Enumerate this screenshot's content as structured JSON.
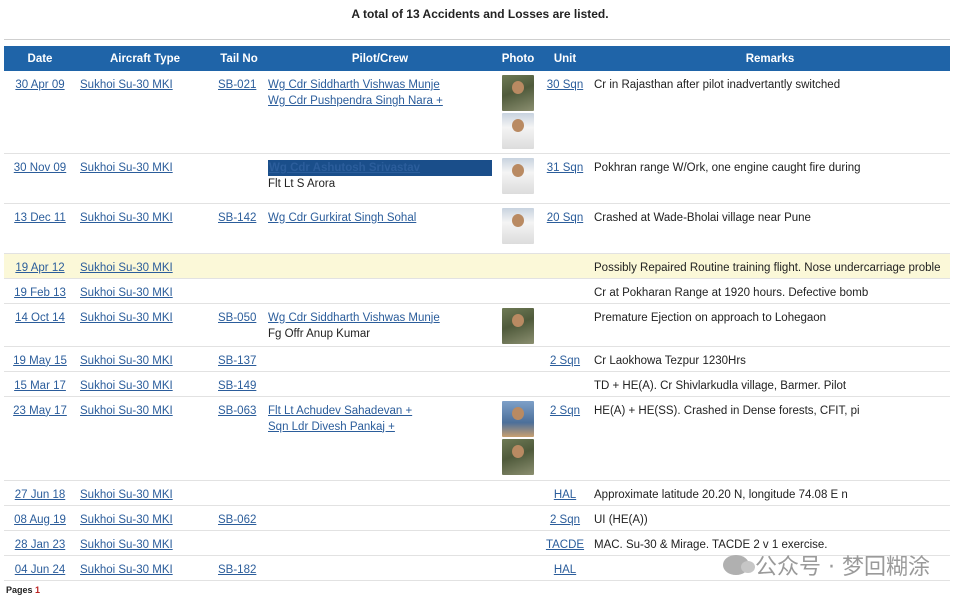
{
  "summary": "A total of 13 Accidents and Losses are listed.",
  "columns": [
    "Date",
    "Aircraft Type",
    "Tail No",
    "Pilot/Crew",
    "Photo",
    "Unit",
    "Remarks"
  ],
  "rows": [
    {
      "date": "30 Apr 09",
      "aircraft": "Sukhoi Su-30 MKI",
      "tail": "SB-021",
      "crew": [
        "Wg Cdr Siddharth Vishwas Munje",
        "Wg Cdr Pushpendra Singh Nara +"
      ],
      "crew_links": [
        true,
        true
      ],
      "photos": [
        "camo",
        "white"
      ],
      "unit": "30 Sqn",
      "remarks": "Cr in Rajasthan after pilot inadvertantly switched"
    },
    {
      "date": "30 Nov 09",
      "aircraft": "Sukhoi Su-30 MKI",
      "tail": "",
      "crew": [
        "Wg Cdr Ashutosh Srivastav",
        "Flt Lt S Arora"
      ],
      "crew_links": [
        true,
        false
      ],
      "photos": [
        "white"
      ],
      "unit": "31 Sqn",
      "remarks": "Pokhran range W/Ork, one engine caught fire during"
    },
    {
      "date": "13 Dec 11",
      "aircraft": "Sukhoi Su-30 MKI",
      "tail": "SB-142",
      "crew": [
        "Wg Cdr Gurkirat Singh Sohal"
      ],
      "crew_links": [
        true
      ],
      "photos": [
        "white"
      ],
      "unit": "20 Sqn",
      "remarks": "Crashed at Wade-Bholai village near Pune"
    },
    {
      "date": "19 Apr 12",
      "aircraft": "Sukhoi Su-30 MKI",
      "tail": "",
      "crew": [],
      "crew_links": [],
      "photos": [],
      "unit": "",
      "remarks": "Possibly Repaired Routine training flight. Nose undercarriage proble",
      "highlight": true
    },
    {
      "date": "19 Feb 13",
      "aircraft": "Sukhoi Su-30 MKI",
      "tail": "",
      "crew": [],
      "crew_links": [],
      "photos": [],
      "unit": "",
      "remarks": "Cr at Pokharan Range at 1920 hours. Defective bomb"
    },
    {
      "date": "14 Oct 14",
      "aircraft": "Sukhoi Su-30 MKI",
      "tail": "SB-050",
      "crew": [
        "Wg Cdr Siddharth Vishwas Munje",
        "Fg Offr Anup Kumar"
      ],
      "crew_links": [
        true,
        false
      ],
      "photos": [
        "camo"
      ],
      "unit": "",
      "remarks": "Premature Ejection on approach to Lohegaon"
    },
    {
      "date": "19 May 15",
      "aircraft": "Sukhoi Su-30 MKI",
      "tail": "SB-137",
      "crew": [],
      "crew_links": [],
      "photos": [],
      "unit": "2 Sqn",
      "remarks": "Cr Laokhowa Tezpur 1230Hrs"
    },
    {
      "date": "15 Mar 17",
      "aircraft": "Sukhoi Su-30 MKI",
      "tail": "SB-149",
      "crew": [],
      "crew_links": [],
      "photos": [],
      "unit": "",
      "remarks": "TD + HE(A). Cr Shivlarkudla village, Barmer. Pilot"
    },
    {
      "date": "23 May 17",
      "aircraft": "Sukhoi Su-30 MKI",
      "tail": "SB-063",
      "crew": [
        "Flt Lt Achudev Sahadevan +",
        "Sqn Ldr Divesh Pankaj +"
      ],
      "crew_links": [
        true,
        true
      ],
      "photos": [
        "blue",
        "camo"
      ],
      "unit": "2 Sqn",
      "remarks": "HE(A) + HE(SS). Crashed in Dense forests, CFIT, pi"
    },
    {
      "date": "27 Jun 18",
      "aircraft": "Sukhoi Su-30 MKI",
      "tail": "",
      "crew": [],
      "crew_links": [],
      "photos": [],
      "unit": "HAL",
      "remarks": "Approximate latitude 20.20 N, longitude 74.08 E n"
    },
    {
      "date": "08 Aug 19",
      "aircraft": "Sukhoi Su-30 MKI",
      "tail": "SB-062",
      "crew": [],
      "crew_links": [],
      "photos": [],
      "unit": "2 Sqn",
      "remarks": "UI (HE(A))"
    },
    {
      "date": "28 Jan 23",
      "aircraft": "Sukhoi Su-30 MKI",
      "tail": "",
      "crew": [],
      "crew_links": [],
      "photos": [],
      "unit": "TACDE",
      "remarks": "MAC. Su-30 & Mirage. TACDE 2 v 1 exercise."
    },
    {
      "date": "04 Jun 24",
      "aircraft": "Sukhoi Su-30 MKI",
      "tail": "SB-182",
      "crew": [],
      "crew_links": [],
      "photos": [],
      "unit": "HAL",
      "remarks": ""
    }
  ],
  "watermark": "公众号 · 梦回糊涂",
  "pages": {
    "label": "Pages",
    "current": "1"
  },
  "colors": {
    "header_bg": "#1f64a8",
    "link": "#2b5d9b",
    "highlight_row": "#fbf8d8"
  }
}
